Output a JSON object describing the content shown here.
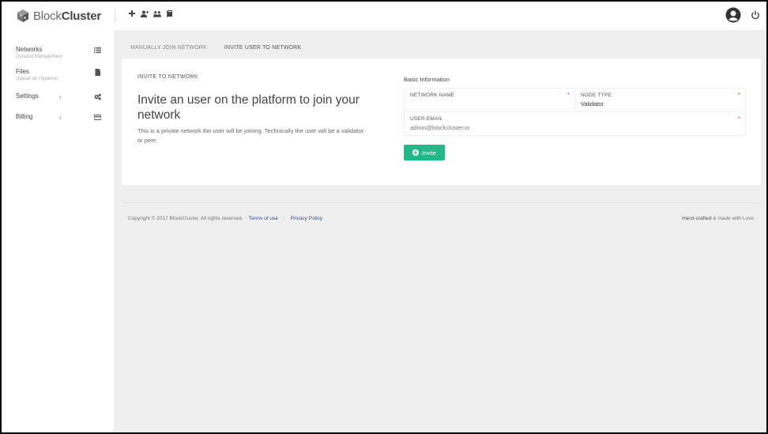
{
  "app": {
    "logo_light": "Block",
    "logo_bold": "Cluster"
  },
  "topbar": {
    "actions": [
      "plus-icon",
      "add-user-icon",
      "users-icon",
      "book-icon"
    ],
    "right": [
      "user-avatar-icon",
      "power-icon"
    ]
  },
  "sidebar": {
    "items": [
      {
        "label": "Networks",
        "sub": "Dynamo Management",
        "icon": "list-icon"
      },
      {
        "label": "Files",
        "sub": "Upload on Hyperion",
        "icon": "file-icon"
      },
      {
        "label": "Settings",
        "sub": "",
        "icon": "gears-icon",
        "chevron": "‹"
      },
      {
        "label": "Billing",
        "sub": "",
        "icon": "credit-card-icon",
        "chevron": "‹"
      }
    ]
  },
  "tabs": [
    {
      "label": "MANUALLY JOIN NETWORK",
      "active": false
    },
    {
      "label": "INVITE USER TO NETWORK",
      "active": true
    }
  ],
  "invite": {
    "section_title": "INVITE TO NETWORK",
    "heading": "Invite an user on the platform to join your network",
    "description": "This is a private network the user will be joining. Technically the user will be a validator or peer."
  },
  "form": {
    "title": "Basic Information",
    "network_name_label": "NETWORK NAME",
    "network_name_value": "",
    "node_type_label": "NODE TYPE",
    "node_type_value": "Validator",
    "user_email_label": "USER EMAIL",
    "user_email_placeholder": "admin@blockcluster.io",
    "required_mark": "*",
    "invite_button": "Invite"
  },
  "footer": {
    "copyright": "Copyright © 2017 BlockCluster. All rights reserved.",
    "terms": "Terms of use",
    "separator": "|",
    "privacy": "Privacy Policy",
    "handcrafted": "Hand-crafted",
    "made_with": " & made with Love"
  },
  "colors": {
    "accent": "#25b78a",
    "required": "#e44444",
    "link": "#3a4a8a",
    "main_bg": "#efefef"
  }
}
